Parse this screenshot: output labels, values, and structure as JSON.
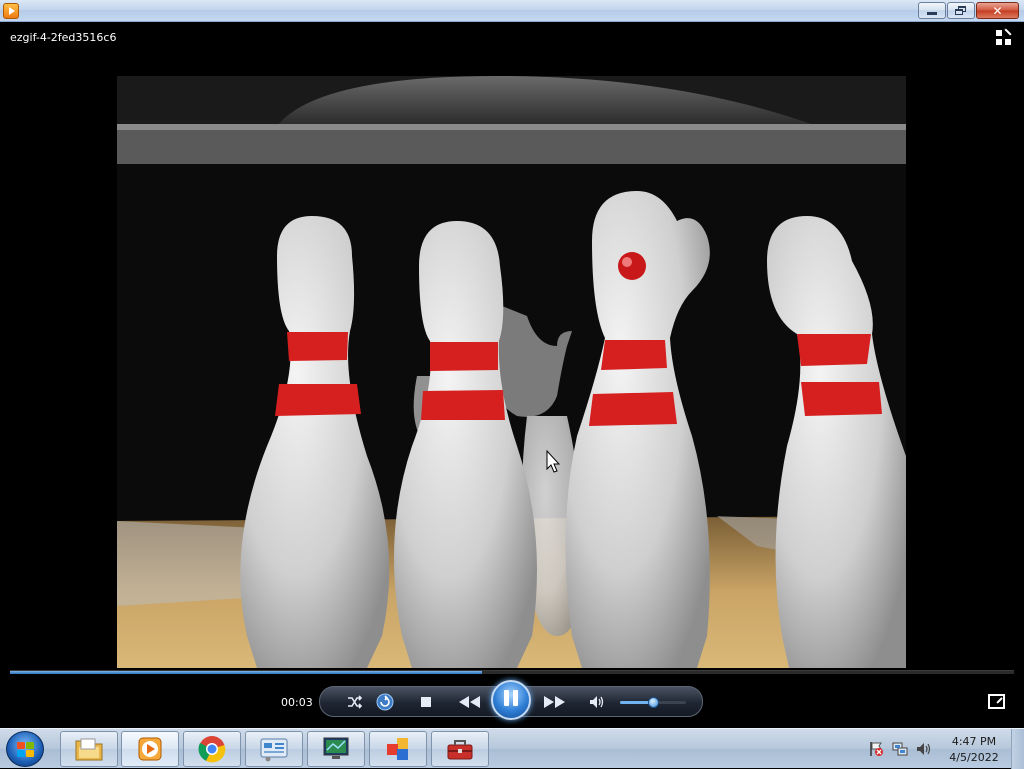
{
  "window": {
    "title_bar_text": "",
    "file_title": "ezgif-4-2fed3516c6",
    "buttons": {
      "minimize": "minimize",
      "maximize": "restore",
      "close": "close"
    }
  },
  "player": {
    "elapsed_time": "00:03",
    "progress_fraction": 0.47,
    "volume_fraction": 0.5,
    "state": "playing",
    "controls": {
      "shuffle": "shuffle-icon",
      "repeat": "repeat-icon",
      "stop": "stop-icon",
      "previous": "rewind-icon",
      "play_pause": "pause-icon",
      "next": "fast-forward-icon",
      "mute": "speaker-icon",
      "switch_to_library": "switch-to-library-icon",
      "full_screen": "full-screen-icon"
    }
  },
  "taskbar": {
    "start": "windows-start-icon",
    "pinned": [
      {
        "name": "windows-explorer",
        "icon": "folder-icon"
      },
      {
        "name": "windows-media-player",
        "icon": "media-player-icon",
        "active": true
      },
      {
        "name": "google-chrome",
        "icon": "chrome-icon"
      },
      {
        "name": "control-panel",
        "icon": "control-panel-icon"
      },
      {
        "name": "remote-desktop",
        "icon": "monitor-icon"
      },
      {
        "name": "app-blocks",
        "icon": "colored-blocks-icon"
      },
      {
        "name": "toolbox",
        "icon": "toolbox-icon"
      }
    ],
    "tray": {
      "icons": [
        "action-center-flag-icon",
        "network-icon",
        "volume-icon"
      ],
      "time": "4:47 PM",
      "date": "4/5/2022"
    }
  },
  "colors": {
    "accent_blue": "#2f7fd6",
    "pin_red": "#d61f1f",
    "lane": "#c9a466"
  }
}
